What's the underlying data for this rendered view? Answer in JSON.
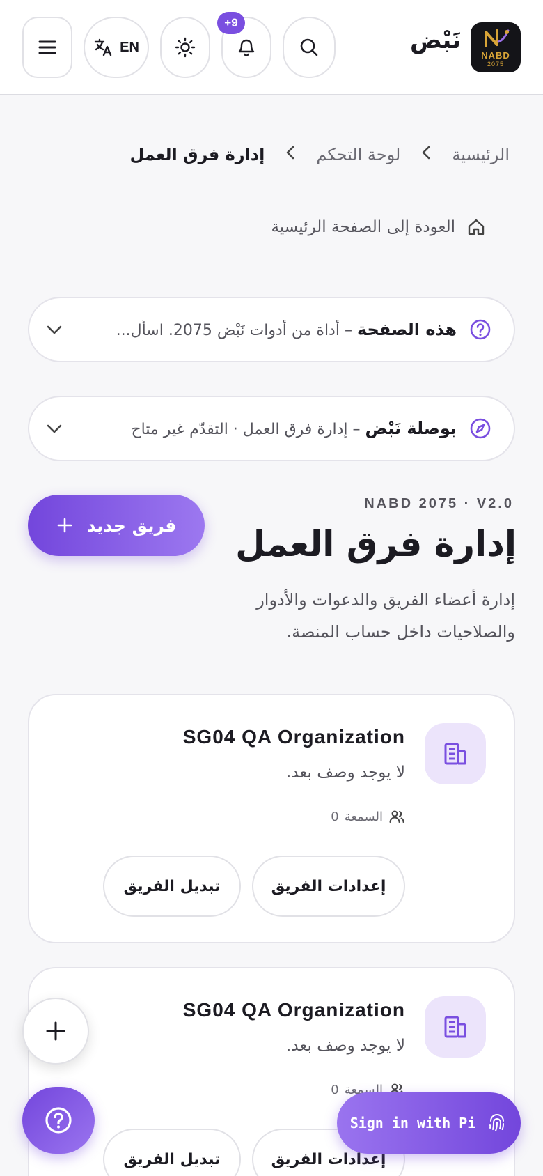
{
  "header": {
    "brand_name": "نَبْض",
    "logo_line1": "NABD",
    "logo_line2": "2075",
    "lang_label": "EN",
    "notification_badge": "+9",
    "icons": [
      "menu-icon",
      "translate-icon",
      "sun-icon",
      "bell-icon",
      "search-icon"
    ]
  },
  "breadcrumb": {
    "home": "الرئيسية",
    "dashboard": "لوحة التحكم",
    "current": "إدارة فرق العمل"
  },
  "back_link": {
    "label": "العودة إلى الصفحة الرئيسية"
  },
  "page_info": {
    "title": "هذه الصفحة",
    "text": " – أداة من أدوات نَبْض 2075. اسأل..."
  },
  "compass": {
    "title": "بوصلة نَبْض",
    "text": " – إدارة فرق العمل · التقدّم غير متاح"
  },
  "hero": {
    "eyebrow": "NABD 2075 · V2.0",
    "title": "إدارة فرق العمل",
    "description": "إدارة أعضاء الفريق والدعوات والأدوار والصلاحيات داخل حساب المنصة.",
    "new_team_label": "فريق جديد"
  },
  "teams": [
    {
      "name": "SG04 QA Organization",
      "description": "لا يوجد وصف بعد.",
      "meta_label": "السمعة",
      "meta_value": "0",
      "settings_label": "إعدادات الفريق",
      "switch_label": "تبديل الفريق"
    },
    {
      "name": "SG04 QA Organization",
      "description": "لا يوجد وصف بعد.",
      "meta_label": "السمعة",
      "meta_value": "0",
      "settings_label": "إعدادات الفريق",
      "switch_label": "تبديل الفريق"
    }
  ],
  "signin": {
    "label": "Sign in with Pi"
  },
  "colors": {
    "accent": "#7a4fe0",
    "accent_light": "#ece4fb",
    "background": "#f7f7f9"
  }
}
